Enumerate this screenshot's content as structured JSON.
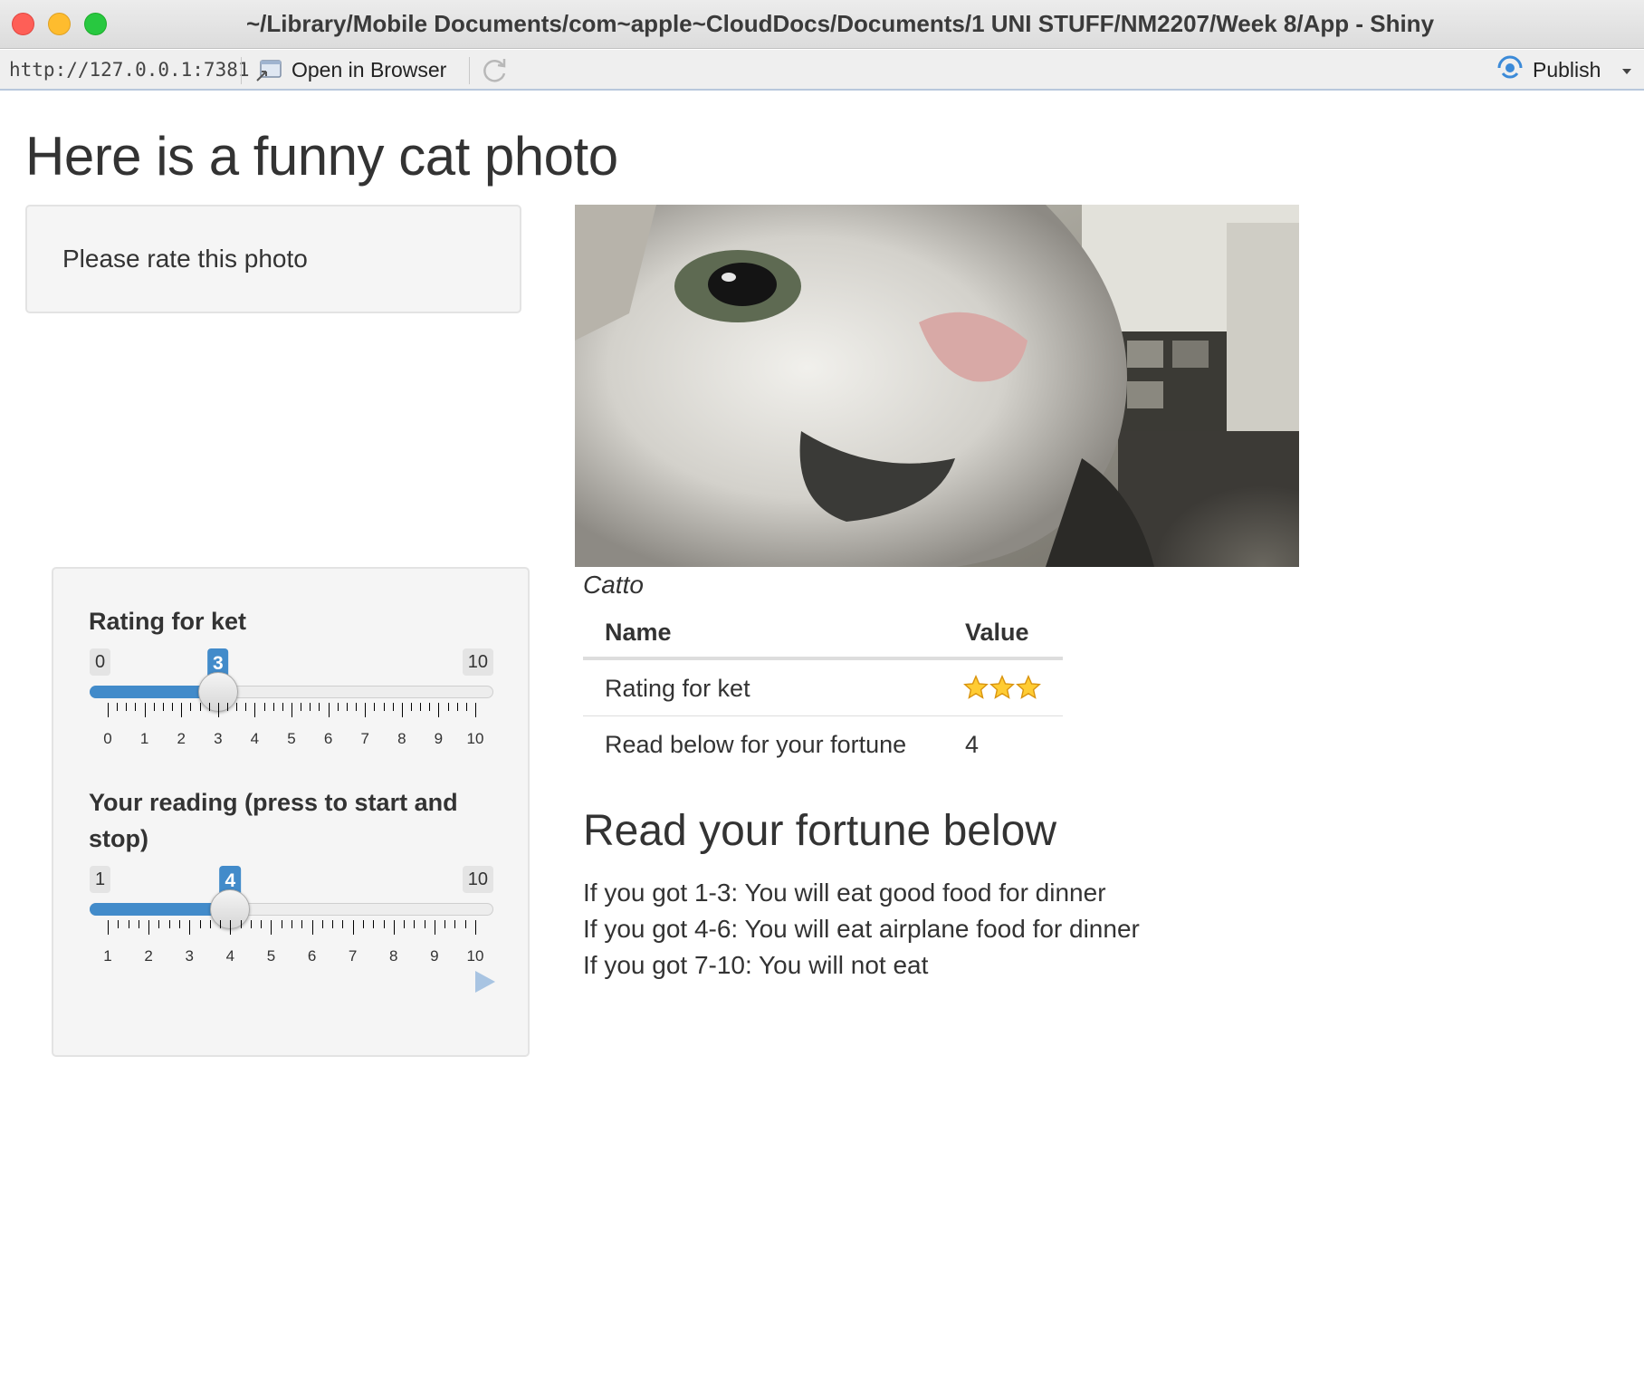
{
  "window": {
    "title": "~/Library/Mobile Documents/com~apple~CloudDocs/Documents/1 UNI STUFF/NM2207/Week 8/App - Shiny"
  },
  "toolbar": {
    "url": "http://127.0.0.1:7381",
    "open_in_browser": "Open in Browser",
    "publish": "Publish",
    "icons": [
      "open-in-browser-icon",
      "refresh-icon",
      "publish-icon",
      "chevron-down-icon"
    ],
    "accent_color": "#3b8ad8"
  },
  "page": {
    "title": "Here is a funny cat photo"
  },
  "sidebar": {
    "prompt": "Please rate this photo",
    "sliders": [
      {
        "label": "Rating for ket",
        "min": "0",
        "max": "10",
        "value": "3",
        "min_num": 0,
        "max_num": 10,
        "value_num": 3,
        "tick_labels": [
          "0",
          "1",
          "2",
          "3",
          "4",
          "5",
          "6",
          "7",
          "8",
          "9",
          "10"
        ]
      },
      {
        "label": "Your reading (press to start and stop)",
        "min": "1",
        "max": "10",
        "value": "4",
        "min_num": 1,
        "max_num": 10,
        "value_num": 4,
        "tick_labels": [
          "1",
          "2",
          "3",
          "4",
          "5",
          "6",
          "7",
          "8",
          "9",
          "10"
        ],
        "has_play_button": true
      }
    ],
    "accent_color": "#428bca"
  },
  "main": {
    "image_caption": "Catto",
    "table": {
      "headers": [
        "Name",
        "Value"
      ],
      "rows": [
        {
          "name": "Rating for ket",
          "value": "3",
          "display": "stars",
          "stars": 3
        },
        {
          "name": "Read below for your fortune",
          "value": "4"
        }
      ]
    },
    "fortune_title": "Read your fortune below",
    "fortune_lines": [
      "If you got 1-3: You will eat good food for dinner",
      "If you got 4-6: You will eat airplane food for dinner",
      "If you got 7-10: You will not eat"
    ]
  }
}
